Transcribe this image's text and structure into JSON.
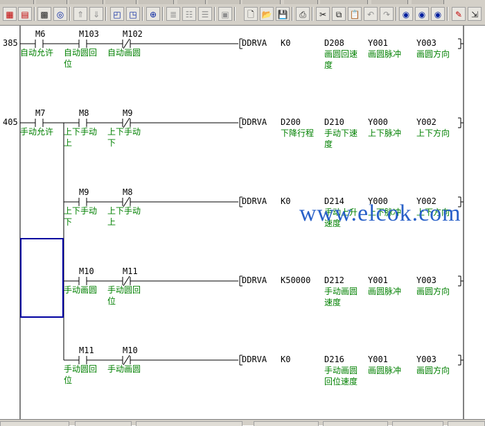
{
  "toolbar": {
    "buttons": [
      {
        "name": "ladder-edit-icon",
        "glyph": "▦"
      },
      {
        "name": "ladder-monitor-icon",
        "glyph": "▤"
      },
      {
        "name": "device-grid-icon",
        "glyph": "▩"
      },
      {
        "name": "device-search-icon",
        "glyph": "◎"
      },
      {
        "name": "jump-up-icon",
        "glyph": "⇑"
      },
      {
        "name": "jump-down-icon",
        "glyph": "⇓"
      },
      {
        "name": "window-left-icon",
        "glyph": "◰"
      },
      {
        "name": "window-right-icon",
        "glyph": "◳"
      },
      {
        "name": "zoom-icon",
        "glyph": "⊕"
      },
      {
        "name": "comment-icon",
        "glyph": "≣"
      },
      {
        "name": "statement-icon",
        "glyph": "☷"
      },
      {
        "name": "note-icon",
        "glyph": "☰"
      },
      {
        "name": "display-icon",
        "glyph": "▣"
      },
      {
        "name": "new-file-icon",
        "glyph": "🗋"
      },
      {
        "name": "open-file-icon",
        "glyph": "📂"
      },
      {
        "name": "save-file-icon",
        "glyph": "💾"
      },
      {
        "name": "print-icon",
        "glyph": "⎙"
      },
      {
        "name": "cut-icon",
        "glyph": "✂"
      },
      {
        "name": "copy-icon",
        "glyph": "⧉"
      },
      {
        "name": "paste-icon",
        "glyph": "📋"
      },
      {
        "name": "undo-icon",
        "glyph": "↶"
      },
      {
        "name": "redo-icon",
        "glyph": "↷"
      },
      {
        "name": "find-icon",
        "glyph": "◉"
      },
      {
        "name": "find-next-icon",
        "glyph": "◉"
      },
      {
        "name": "find-replace-icon",
        "glyph": "◉"
      },
      {
        "name": "write-plc-icon",
        "glyph": "✎"
      },
      {
        "name": "read-plc-icon",
        "glyph": "⇲"
      }
    ]
  },
  "rungs": [
    {
      "step": "385",
      "contacts": [
        {
          "device": "M6",
          "comment": "自动允许",
          "type": "NO"
        },
        {
          "device": "M103",
          "comment": "自动圆回位",
          "type": "NO"
        },
        {
          "device": "M102",
          "comment": "自动画圆",
          "type": "NC"
        }
      ],
      "instruction": {
        "op": "DDRVA",
        "args": [
          {
            "device": "K0",
            "comment": ""
          },
          {
            "device": "D208",
            "comment": "画圆回速度"
          },
          {
            "device": "Y001",
            "comment": "画圆脉冲"
          },
          {
            "device": "Y003",
            "comment": "画圆方向"
          }
        ]
      }
    },
    {
      "step": "405",
      "contacts": [
        {
          "device": "M7",
          "comment": "手动允许",
          "type": "NO"
        },
        {
          "device": "M8",
          "comment": "上下手动上",
          "type": "NO"
        },
        {
          "device": "M9",
          "comment": "上下手动下",
          "type": "NC"
        }
      ],
      "instruction": {
        "op": "DDRVA",
        "args": [
          {
            "device": "D200",
            "comment": "下降行程"
          },
          {
            "device": "D210",
            "comment": "手动下速度"
          },
          {
            "device": "Y000",
            "comment": "上下脉冲"
          },
          {
            "device": "Y002",
            "comment": "上下方向"
          }
        ]
      }
    },
    {
      "step": "",
      "contacts": [
        {
          "device": "M9",
          "comment": "上下手动下",
          "type": "NO"
        },
        {
          "device": "M8",
          "comment": "上下手动上",
          "type": "NC"
        }
      ],
      "instruction": {
        "op": "DDRVA",
        "args": [
          {
            "device": "K0",
            "comment": ""
          },
          {
            "device": "D214",
            "comment": "手动上升速度"
          },
          {
            "device": "Y000",
            "comment": "上下脉冲"
          },
          {
            "device": "Y002",
            "comment": "上下方向"
          }
        ]
      }
    },
    {
      "step": "",
      "contacts": [
        {
          "device": "M10",
          "comment": "手动画圆",
          "type": "NO"
        },
        {
          "device": "M11",
          "comment": "手动圆回位",
          "type": "NC"
        }
      ],
      "instruction": {
        "op": "DDRVA",
        "args": [
          {
            "device": "K50000",
            "comment": ""
          },
          {
            "device": "D212",
            "comment": "手动画圆速度"
          },
          {
            "device": "Y001",
            "comment": "画圆脉冲"
          },
          {
            "device": "Y003",
            "comment": "画圆方向"
          }
        ]
      }
    },
    {
      "step": "",
      "contacts": [
        {
          "device": "M11",
          "comment": "手动圆回位",
          "type": "NO"
        },
        {
          "device": "M10",
          "comment": "手动画圆",
          "type": "NC"
        }
      ],
      "instruction": {
        "op": "DDRVA",
        "args": [
          {
            "device": "K0",
            "comment": ""
          },
          {
            "device": "D216",
            "comment": "手动画圆回位速度"
          },
          {
            "device": "Y001",
            "comment": "画圆脉冲"
          },
          {
            "device": "Y003",
            "comment": "画圆方向"
          }
        ]
      }
    }
  ],
  "watermark": "www.elcok.com",
  "colors": {
    "comment": "#008000",
    "watermark": "#2860c8",
    "selection": "#0000a0",
    "toolbar": "#d4d0c8"
  }
}
